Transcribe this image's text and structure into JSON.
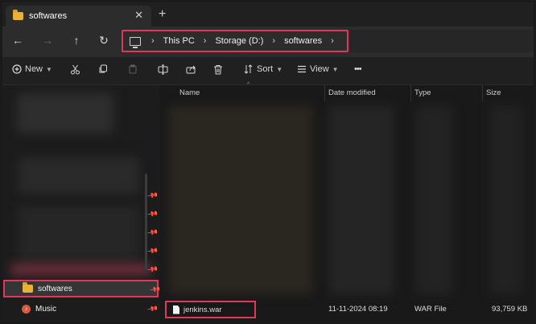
{
  "tab": {
    "title": "softwares",
    "close": "✕",
    "new_tab": "+"
  },
  "nav": {
    "back": "←",
    "forward": "→",
    "up": "↑",
    "refresh": "↻"
  },
  "breadcrumb": {
    "items": [
      "This PC",
      "Storage (D:)",
      "softwares"
    ],
    "separator": "›"
  },
  "toolbar": {
    "new_label": "New",
    "sort_label": "Sort",
    "view_label": "View",
    "more_label": "•••"
  },
  "columns": {
    "name": "Name",
    "date_modified": "Date modified",
    "type": "Type",
    "size": "Size"
  },
  "sidebar": {
    "items": [
      {
        "label": "softwares",
        "pinned": true,
        "selected": true
      },
      {
        "label": "Music",
        "pinned": true
      }
    ],
    "pin_glyph": "📌"
  },
  "files": [
    {
      "name": "jenkins.war",
      "date": "11-11-2024 08:19",
      "type": "WAR File",
      "size": "93,759 KB"
    }
  ],
  "colors": {
    "highlight": "#e0375b",
    "folder": "#e8b23a"
  }
}
